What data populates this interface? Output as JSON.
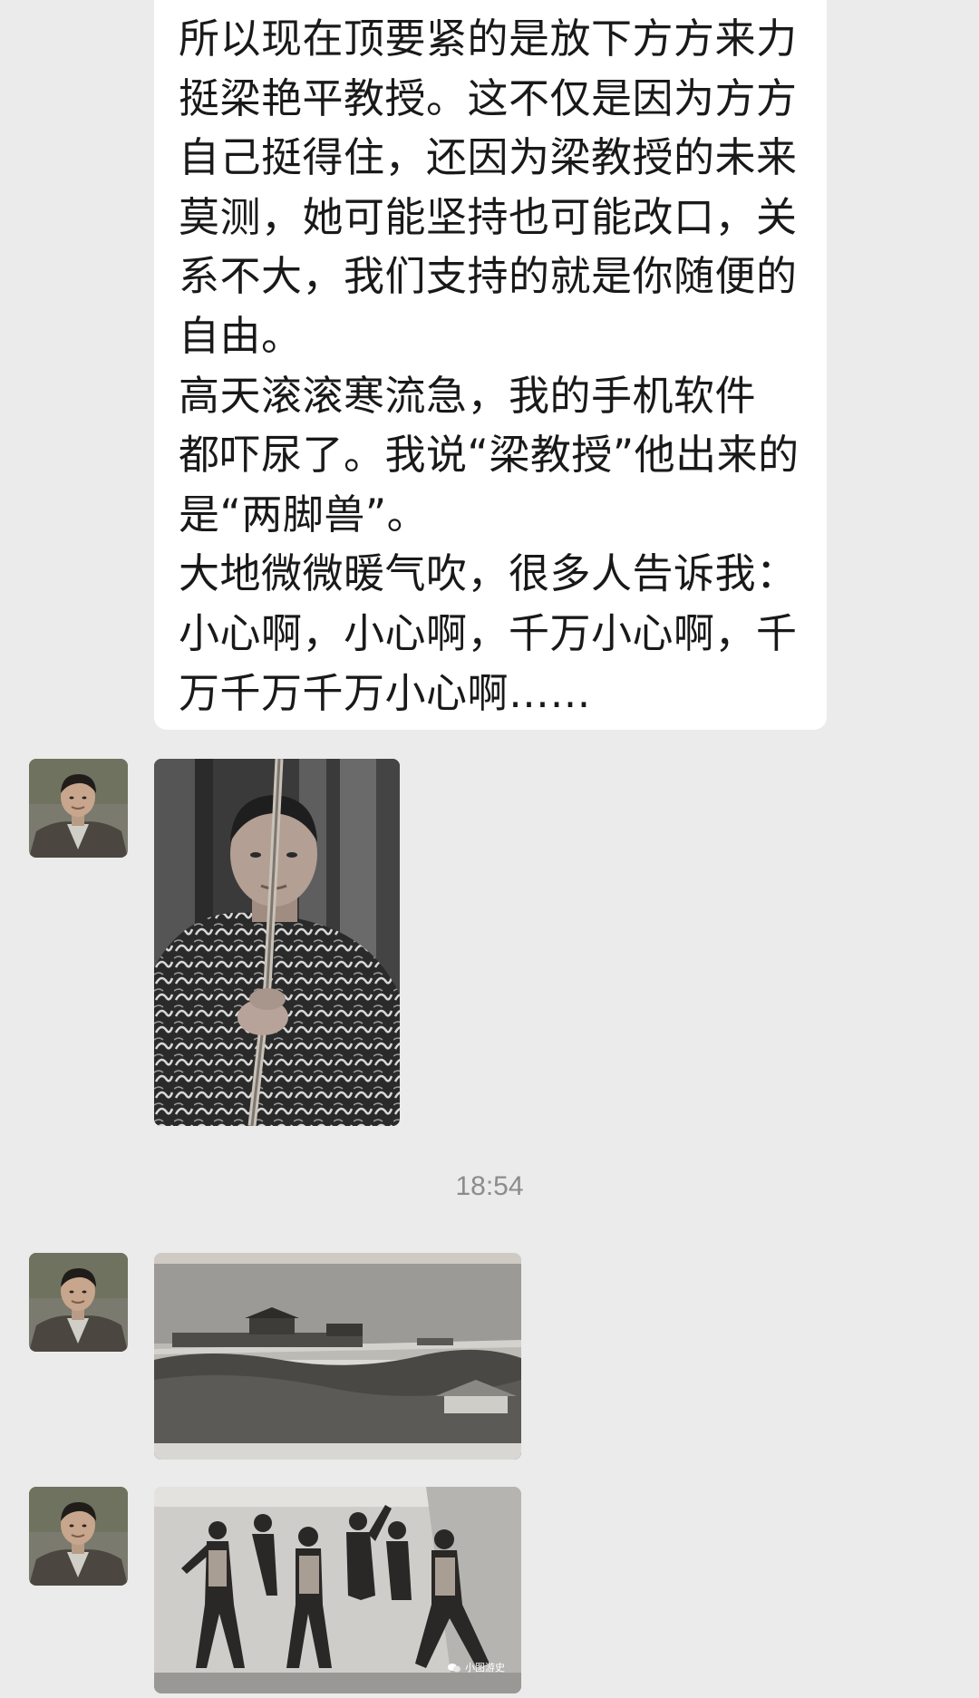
{
  "chat": {
    "message_lines": [
      "所以现在顶要紧的是放下方方来力",
      "挺梁艳平教授。这不仅是因为方方",
      "自己挺得住，还因为梁教授的未来",
      "莫测，她可能坚持也可能改口，关",
      "系不大，我们支持的就是你随便的",
      "自由。",
      "高天滚滚寒流急，我的手机软件",
      "都吓尿了。我说“梁教授”他出来的",
      "是“两脚兽”。",
      "大地微微暖气吹，很多人告诉我：",
      "小心啊，小心啊，千万小心啊，千",
      "万千万千万小心啊……"
    ],
    "timestamp": "18:54",
    "watermark_text": "小图游史",
    "images": [
      {
        "icon": "portrait-photo"
      },
      {
        "icon": "landscape-photo"
      },
      {
        "icon": "group-photo"
      }
    ]
  },
  "colors": {
    "background": "#ebebeb",
    "bubble": "#ffffff",
    "text": "#191919",
    "timestamp": "#8c8c8c"
  }
}
